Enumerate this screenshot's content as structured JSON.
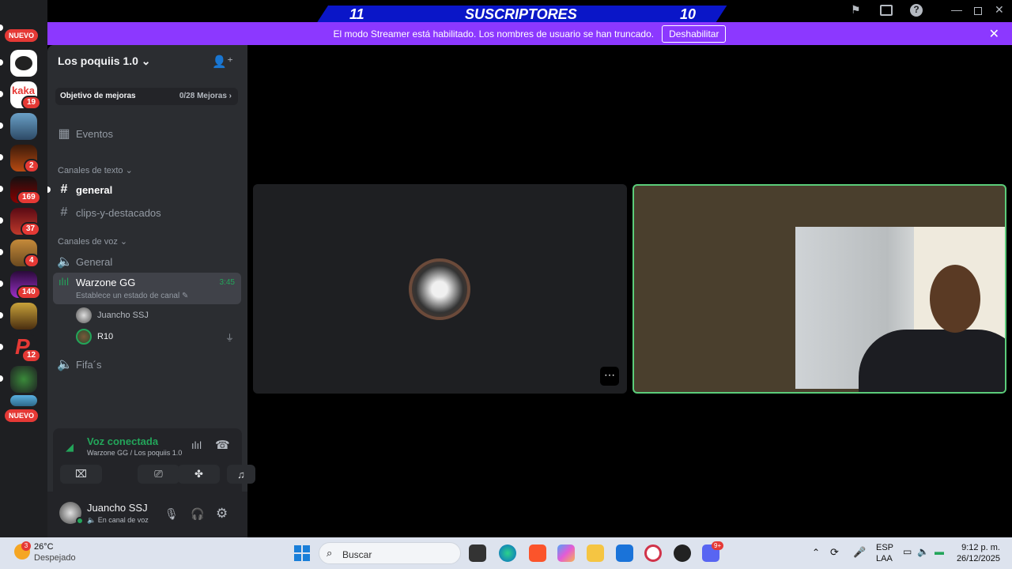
{
  "subs_bar": {
    "left": "11",
    "title": "SUSCRIPTORES",
    "right": "10"
  },
  "banner": {
    "text": "El modo Streamer está habilitado. Los nombres de usuario se han truncado.",
    "button": "Deshabilitar"
  },
  "rail": {
    "nuevo": "NUEVO",
    "badges": [
      "19",
      "2",
      "169",
      "37",
      "4",
      "140",
      "12"
    ]
  },
  "server": {
    "name": "Los poquiis 1.0"
  },
  "boost": {
    "label": "Objetivo de mejoras",
    "value": "0/28 Mejoras"
  },
  "events": "Eventos",
  "text_category": "Canales de texto",
  "text_channels": [
    "general",
    "clips-y-destacados"
  ],
  "voice_category": "Canales de voz",
  "voice_channels": {
    "general": "General",
    "active": {
      "name": "Warzone GG",
      "time": "3:45",
      "status": "Establece un estado de canal"
    },
    "users": [
      "Juancho SSJ",
      "R10"
    ],
    "fifa": "Fifa´s"
  },
  "voice_panel": {
    "title": "Voz conectada",
    "subtitle": "Warzone GG / Los poquiis 1.0"
  },
  "user": {
    "name": "Juancho SSJ",
    "status": "En canal de voz"
  },
  "taskbar": {
    "temp": "26°C",
    "weather": "Despejado",
    "weather_badge": "3",
    "search": "Buscar",
    "lang1": "ESP",
    "lang2": "LAA",
    "time": "9:12 p. m.",
    "date": "26/12/2025",
    "discord_badge": "9+"
  },
  "colors": {
    "accent": "#8c38ff",
    "green": "#23a55a",
    "speaking": "#5bcc7a",
    "badge": "#e53935"
  }
}
